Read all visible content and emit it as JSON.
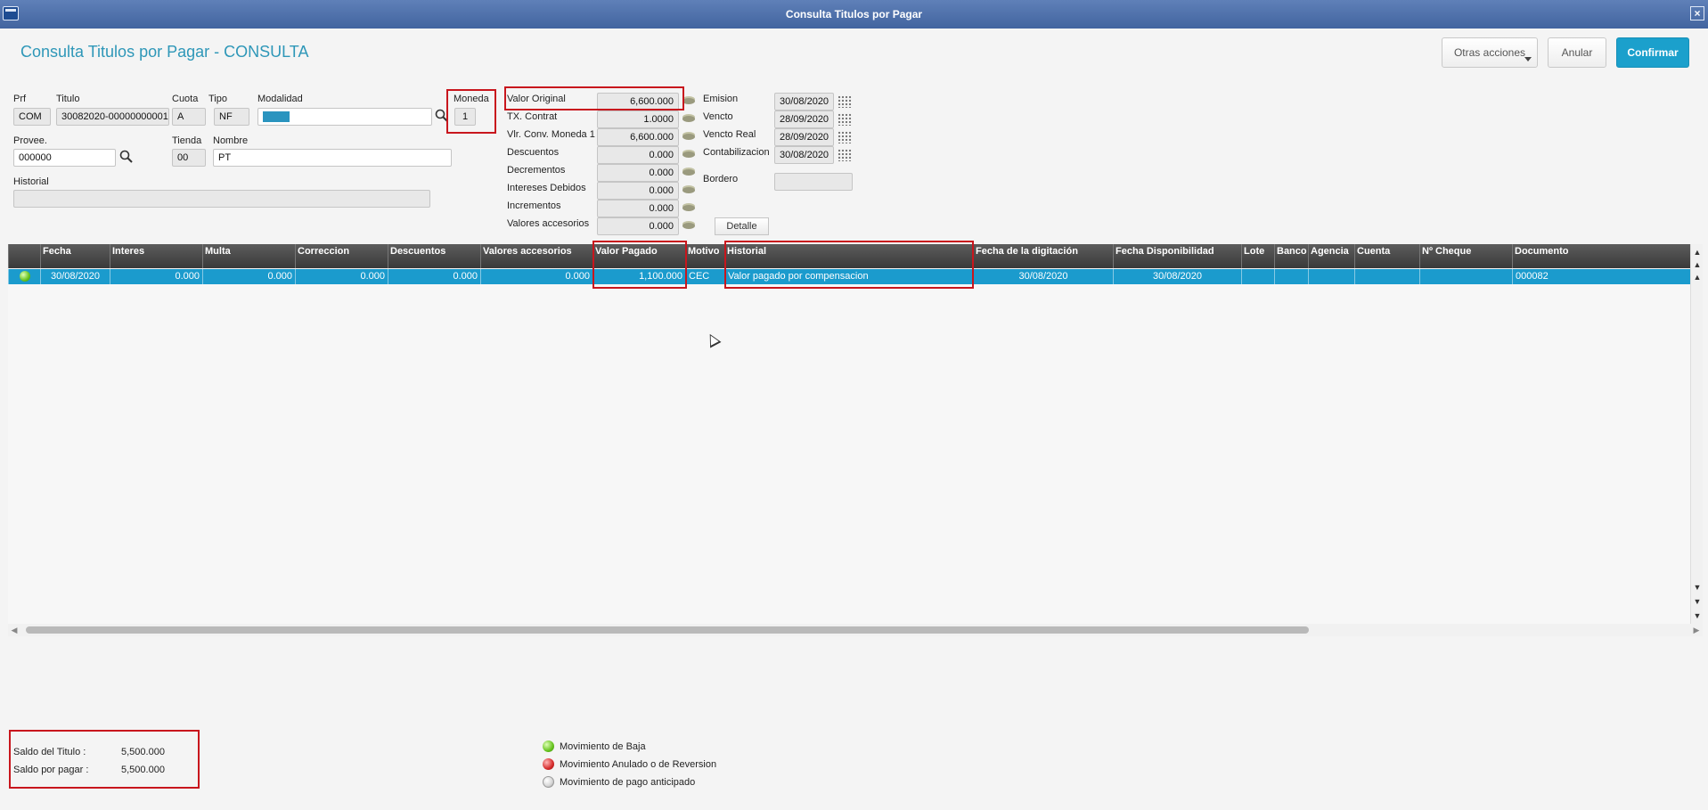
{
  "window": {
    "title": "Consulta Titulos por Pagar",
    "close_glyph": "×"
  },
  "page_title": "Consulta Titulos por Pagar - CONSULTA",
  "toolbar": {
    "more_actions": "Otras acciones",
    "cancel": "Anular",
    "confirm": "Confirmar"
  },
  "header_fields": {
    "prf": {
      "label": "Prf",
      "value": "COM"
    },
    "titulo": {
      "label": "Titulo",
      "value": "30082020-00000000001"
    },
    "cuota": {
      "label": "Cuota",
      "value": "A"
    },
    "tipo": {
      "label": "Tipo",
      "value": "NF"
    },
    "modalidad": {
      "label": "Modalidad",
      "value": ""
    },
    "moneda": {
      "label": "Moneda",
      "value": "1"
    },
    "provee": {
      "label": "Provee.",
      "value": "000000"
    },
    "tienda": {
      "label": "Tienda",
      "value": "00"
    },
    "nombre": {
      "label": "Nombre",
      "value": "PT"
    },
    "historial": {
      "label": "Historial",
      "value": ""
    }
  },
  "values": [
    {
      "label": "Valor Original",
      "value": "6,600.000"
    },
    {
      "label": "TX. Contrat",
      "value": "1.0000"
    },
    {
      "label": "Vlr. Conv. Moneda 1",
      "value": "6,600.000"
    },
    {
      "label": "Descuentos",
      "value": "0.000"
    },
    {
      "label": "Decrementos",
      "value": "0.000"
    },
    {
      "label": "Intereses Debidos",
      "value": "0.000"
    },
    {
      "label": "Incrementos",
      "value": "0.000"
    },
    {
      "label": "Valores accesorios",
      "value": "0.000"
    }
  ],
  "dates": [
    {
      "label": "Emision",
      "value": "30/08/2020"
    },
    {
      "label": "Vencto",
      "value": "28/09/2020"
    },
    {
      "label": "Vencto Real",
      "value": "28/09/2020"
    },
    {
      "label": "Contabilizacion",
      "value": "30/08/2020"
    }
  ],
  "bordero": {
    "label": "Bordero",
    "value": ""
  },
  "detalle_button": "Detalle",
  "grid": {
    "columns": [
      "Fecha",
      "Interes",
      "Multa",
      "Correccion",
      "Descuentos",
      "Valores accesorios",
      "Valor Pagado",
      "Motivo",
      "Historial",
      "Fecha de la digitación",
      "Fecha Disponibilidad",
      "Lote",
      "Banco",
      "Agencia",
      "Cuenta",
      "Nº Cheque",
      "Documento"
    ],
    "rows": [
      [
        "30/08/2020",
        "0.000",
        "0.000",
        "0.000",
        "0.000",
        "0.000",
        "1,100.000",
        "CEC",
        "Valor pagado por compensacion",
        "30/08/2020",
        "30/08/2020",
        "",
        "",
        "",
        "",
        "",
        "000082"
      ]
    ]
  },
  "summary": {
    "saldo_titulo_label": "Saldo del Titulo :",
    "saldo_titulo_value": "5,500.000",
    "saldo_pagar_label": "Saldo por pagar  :",
    "saldo_pagar_value": "5,500.000"
  },
  "legend": {
    "baja": "Movimiento de Baja",
    "anulado": "Movimiento Anulado o de Reversion",
    "anticipado": "Movimiento de pago anticipado"
  },
  "colors": {
    "accent": "#1b9bcd",
    "title": "#2e97b8",
    "highlight_box": "#c8161d"
  }
}
